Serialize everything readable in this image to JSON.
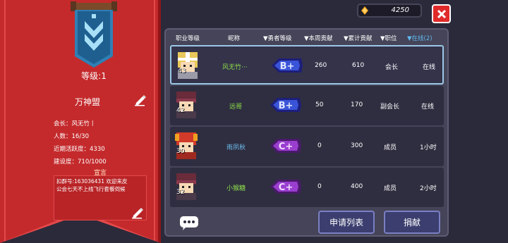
{
  "guild": {
    "level_label": "等级:1",
    "name": "万神盟",
    "leader": "会长：风无竹丨",
    "members": "人数：16/30",
    "activity": "近期活跃度：4330",
    "construction": "建设度：710/1000",
    "notice_title": "宣言",
    "notice_line1": "扣群号:163036431 欢迎来皮",
    "notice_line2": "公会七天不上线飞行套餐伺候"
  },
  "topbar": {
    "gold": "4250"
  },
  "table": {
    "headers": [
      "职业等级",
      "昵称",
      "▼勇者等级",
      "▼本周贡献",
      "▼累计贡献",
      "▼职位",
      "▼在线(2)"
    ],
    "rows": [
      {
        "level": "43",
        "name": "风无竹···",
        "rank": "B+",
        "weekly": "260",
        "total": "610",
        "role": "会长",
        "online": "在线",
        "hero": "knight"
      },
      {
        "level": "42",
        "name": "远哥",
        "rank": "B+",
        "weekly": "50",
        "total": "170",
        "role": "副会长",
        "online": "在线",
        "hero": "rogue"
      },
      {
        "level": "30",
        "name": "雨夙秋",
        "rank": "C+",
        "weekly": "0",
        "total": "300",
        "role": "成员",
        "online": "1小时",
        "hero": "berserker"
      },
      {
        "level": "32",
        "name": "小猴糖",
        "rank": "C+",
        "weekly": "0",
        "total": "400",
        "role": "成员",
        "online": "2小时",
        "hero": "rogue"
      }
    ]
  },
  "buttons": {
    "apply_list": "申请列表",
    "donate": "捐献"
  },
  "colors": {
    "banner_red": "#c42a2c",
    "panel_bg": "#454458",
    "name_green": "#8ee04a",
    "online_blue": "#5fb9f0",
    "close_red": "#e02a2a"
  }
}
